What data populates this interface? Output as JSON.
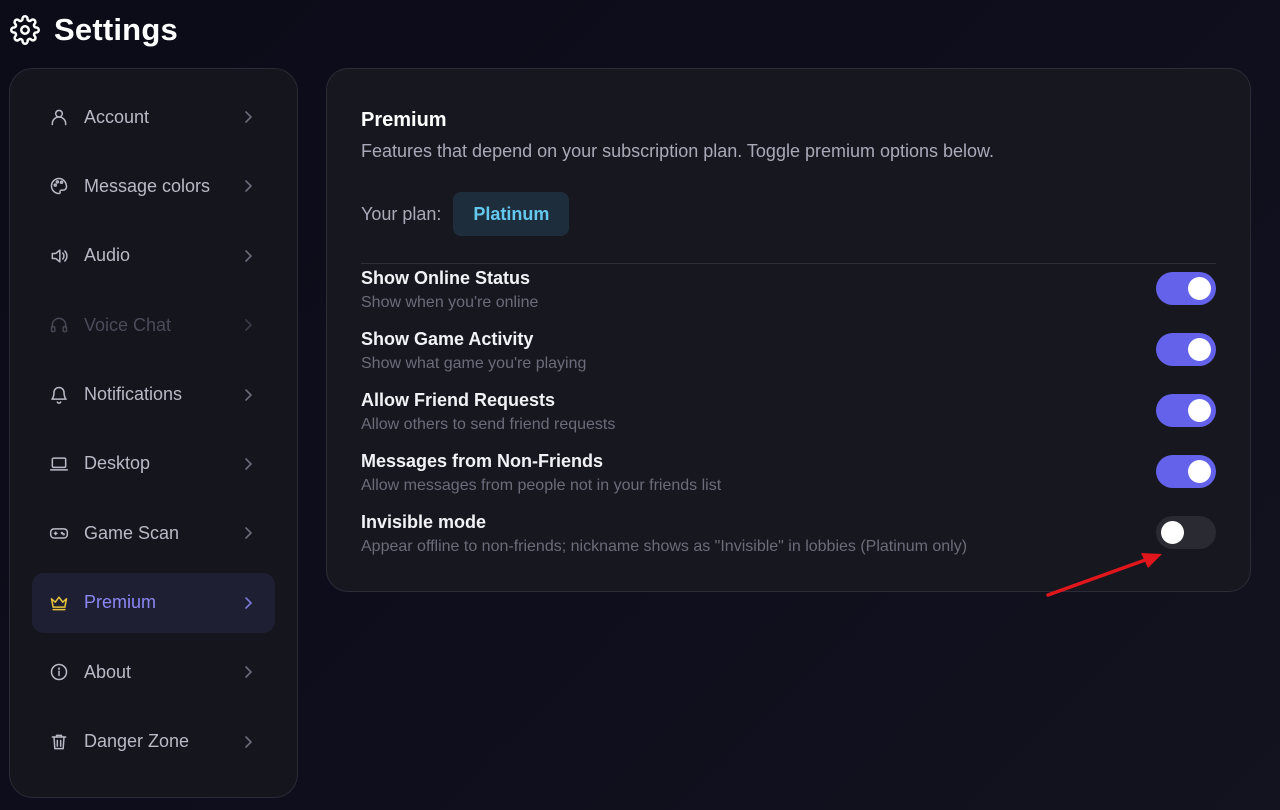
{
  "header": {
    "title": "Settings",
    "icon": "gear-icon"
  },
  "sidebar": {
    "items": [
      {
        "label": "Account",
        "icon": "user-icon",
        "state": "normal"
      },
      {
        "label": "Message colors",
        "icon": "palette-icon",
        "state": "normal"
      },
      {
        "label": "Audio",
        "icon": "speaker-icon",
        "state": "normal"
      },
      {
        "label": "Voice Chat",
        "icon": "headphones-icon",
        "state": "disabled"
      },
      {
        "label": "Notifications",
        "icon": "bell-icon",
        "state": "normal"
      },
      {
        "label": "Desktop",
        "icon": "laptop-icon",
        "state": "normal"
      },
      {
        "label": "Game Scan",
        "icon": "gamepad-icon",
        "state": "normal"
      },
      {
        "label": "Premium",
        "icon": "crown-icon",
        "state": "active"
      },
      {
        "label": "About",
        "icon": "info-icon",
        "state": "normal"
      },
      {
        "label": "Danger Zone",
        "icon": "trash-icon",
        "state": "normal"
      }
    ]
  },
  "panel": {
    "title": "Premium",
    "description": "Features that depend on your subscription plan. Toggle premium options below.",
    "plan_label": "Your plan:",
    "plan_value": "Platinum",
    "settings": [
      {
        "title": "Show Online Status",
        "description": "Show when you're online",
        "enabled": true
      },
      {
        "title": "Show Game Activity",
        "description": "Show what game you're playing",
        "enabled": true
      },
      {
        "title": "Allow Friend Requests",
        "description": "Allow others to send friend requests",
        "enabled": true
      },
      {
        "title": "Messages from Non-Friends",
        "description": "Allow messages from people not in your friends list",
        "enabled": true
      },
      {
        "title": "Invisible mode",
        "description": "Appear offline to non-friends; nickname shows as \"Invisible\" in lobbies (Platinum only)",
        "enabled": false
      }
    ]
  },
  "colors": {
    "accent": "#6462ea",
    "active_text": "#8b87f5",
    "plan_badge_bg": "#1e2d3b",
    "plan_badge_text": "#64c8ee",
    "crown": "#e8c53a",
    "annotation_arrow": "#e0161c"
  }
}
